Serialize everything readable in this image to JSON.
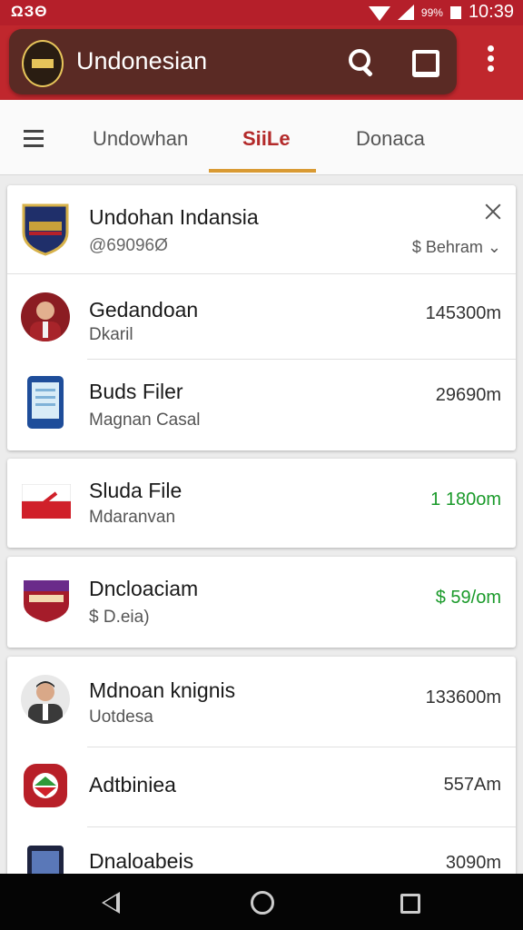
{
  "status_bar": {
    "left_text": "ΩЗΘ",
    "battery_text": "99%",
    "time": "10:39"
  },
  "app_bar": {
    "title": "Undonesian"
  },
  "tabs": [
    {
      "label": "Undowhan"
    },
    {
      "label": "SiiLe"
    },
    {
      "label": "Donaca"
    }
  ],
  "header_card": {
    "title": "Undohan Indansia",
    "subtitle": "@69096Ø",
    "action_label": "$ Behram ⌄"
  },
  "list": [
    {
      "title": "Gedandoan",
      "subtitle": "Dkaril",
      "value": "145300m"
    },
    {
      "title": "Buds Filer",
      "subtitle": "Magnan Casal",
      "value": "29690m"
    },
    {
      "title": "Sluda File",
      "subtitle": "Mdaranvan",
      "value": "1 180om"
    },
    {
      "title": "Dncloaciam",
      "subtitle": "$ D.eia)",
      "value": "$ 59/om"
    },
    {
      "title": "Mdnoan knignis",
      "subtitle": "Uotdesa",
      "value": "133600m"
    },
    {
      "title": "Adtbiniea",
      "subtitle": "",
      "value": "557Am"
    },
    {
      "title": "Dnaloabeis",
      "subtitle": "",
      "value": "3090m"
    }
  ],
  "colors": {
    "brand_red": "#c0272d",
    "app_bar_dark": "#5a2a24",
    "accent_gold": "#d99a33",
    "positive_green": "#1a9a2a"
  }
}
